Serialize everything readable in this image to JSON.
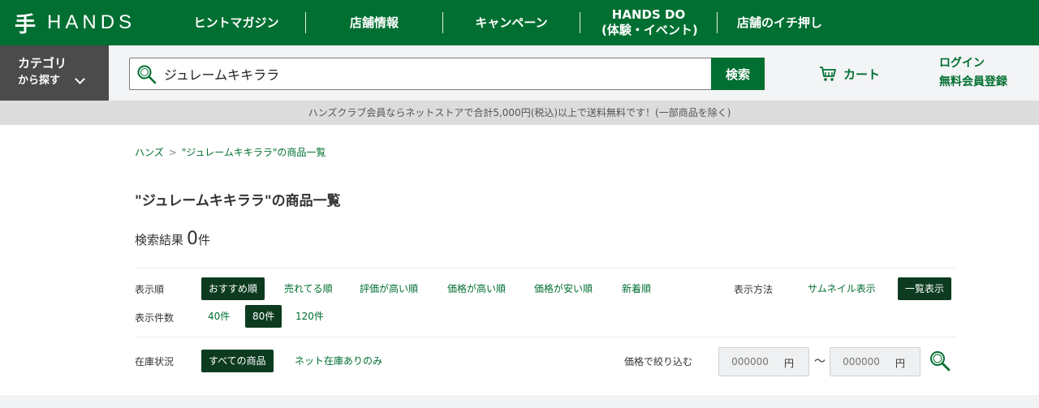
{
  "header": {
    "logo_mark": "手",
    "logo_text": "HANDS",
    "nav": [
      {
        "label": "ヒントマガジン"
      },
      {
        "label": "店舗情報"
      },
      {
        "label": "キャンペーン"
      },
      {
        "label_line1": "HANDS DO",
        "label_line2": "(体験・イベント)"
      },
      {
        "label": "店舗のイチ押し"
      }
    ]
  },
  "subbar": {
    "category_line1": "カテゴリ",
    "category_line2": "から探す",
    "search_value": "ジュレームキキララ",
    "search_button": "検索",
    "cart_label": "カート",
    "login": "ログイン",
    "register": "無料会員登録"
  },
  "notice": "ハンズクラブ会員ならネットストアで合計5,000円(税込)以上で送料無料です！(一部商品を除く)",
  "breadcrumb": {
    "home": "ハンズ",
    "separator": ">",
    "current": "\"ジュレームキキララ\"の商品一覧"
  },
  "page_title": "\"ジュレームキキララ\"の商品一覧",
  "result": {
    "label": "検索結果",
    "count": "0",
    "unit": "件"
  },
  "sort": {
    "label": "表示順",
    "options": [
      "おすすめ順",
      "売れてる順",
      "評価が高い順",
      "価格が高い順",
      "価格が安い順",
      "新着順"
    ],
    "selected": "おすすめ順"
  },
  "view": {
    "label": "表示方法",
    "options": [
      "サムネイル表示",
      "一覧表示"
    ],
    "selected": "一覧表示"
  },
  "per_page": {
    "label": "表示件数",
    "options": [
      "40件",
      "80件",
      "120件"
    ],
    "selected": "80件"
  },
  "stock": {
    "label": "在庫状況",
    "options": [
      "すべての商品",
      "ネット在庫ありのみ"
    ],
    "selected": "すべての商品"
  },
  "price_filter": {
    "label": "価格で絞り込む",
    "min_placeholder": "000000",
    "max_placeholder": "000000",
    "unit": "円",
    "tilde": "〜"
  },
  "colors": {
    "brand_green": "#006f31",
    "active_dark": "#0d3b20"
  }
}
